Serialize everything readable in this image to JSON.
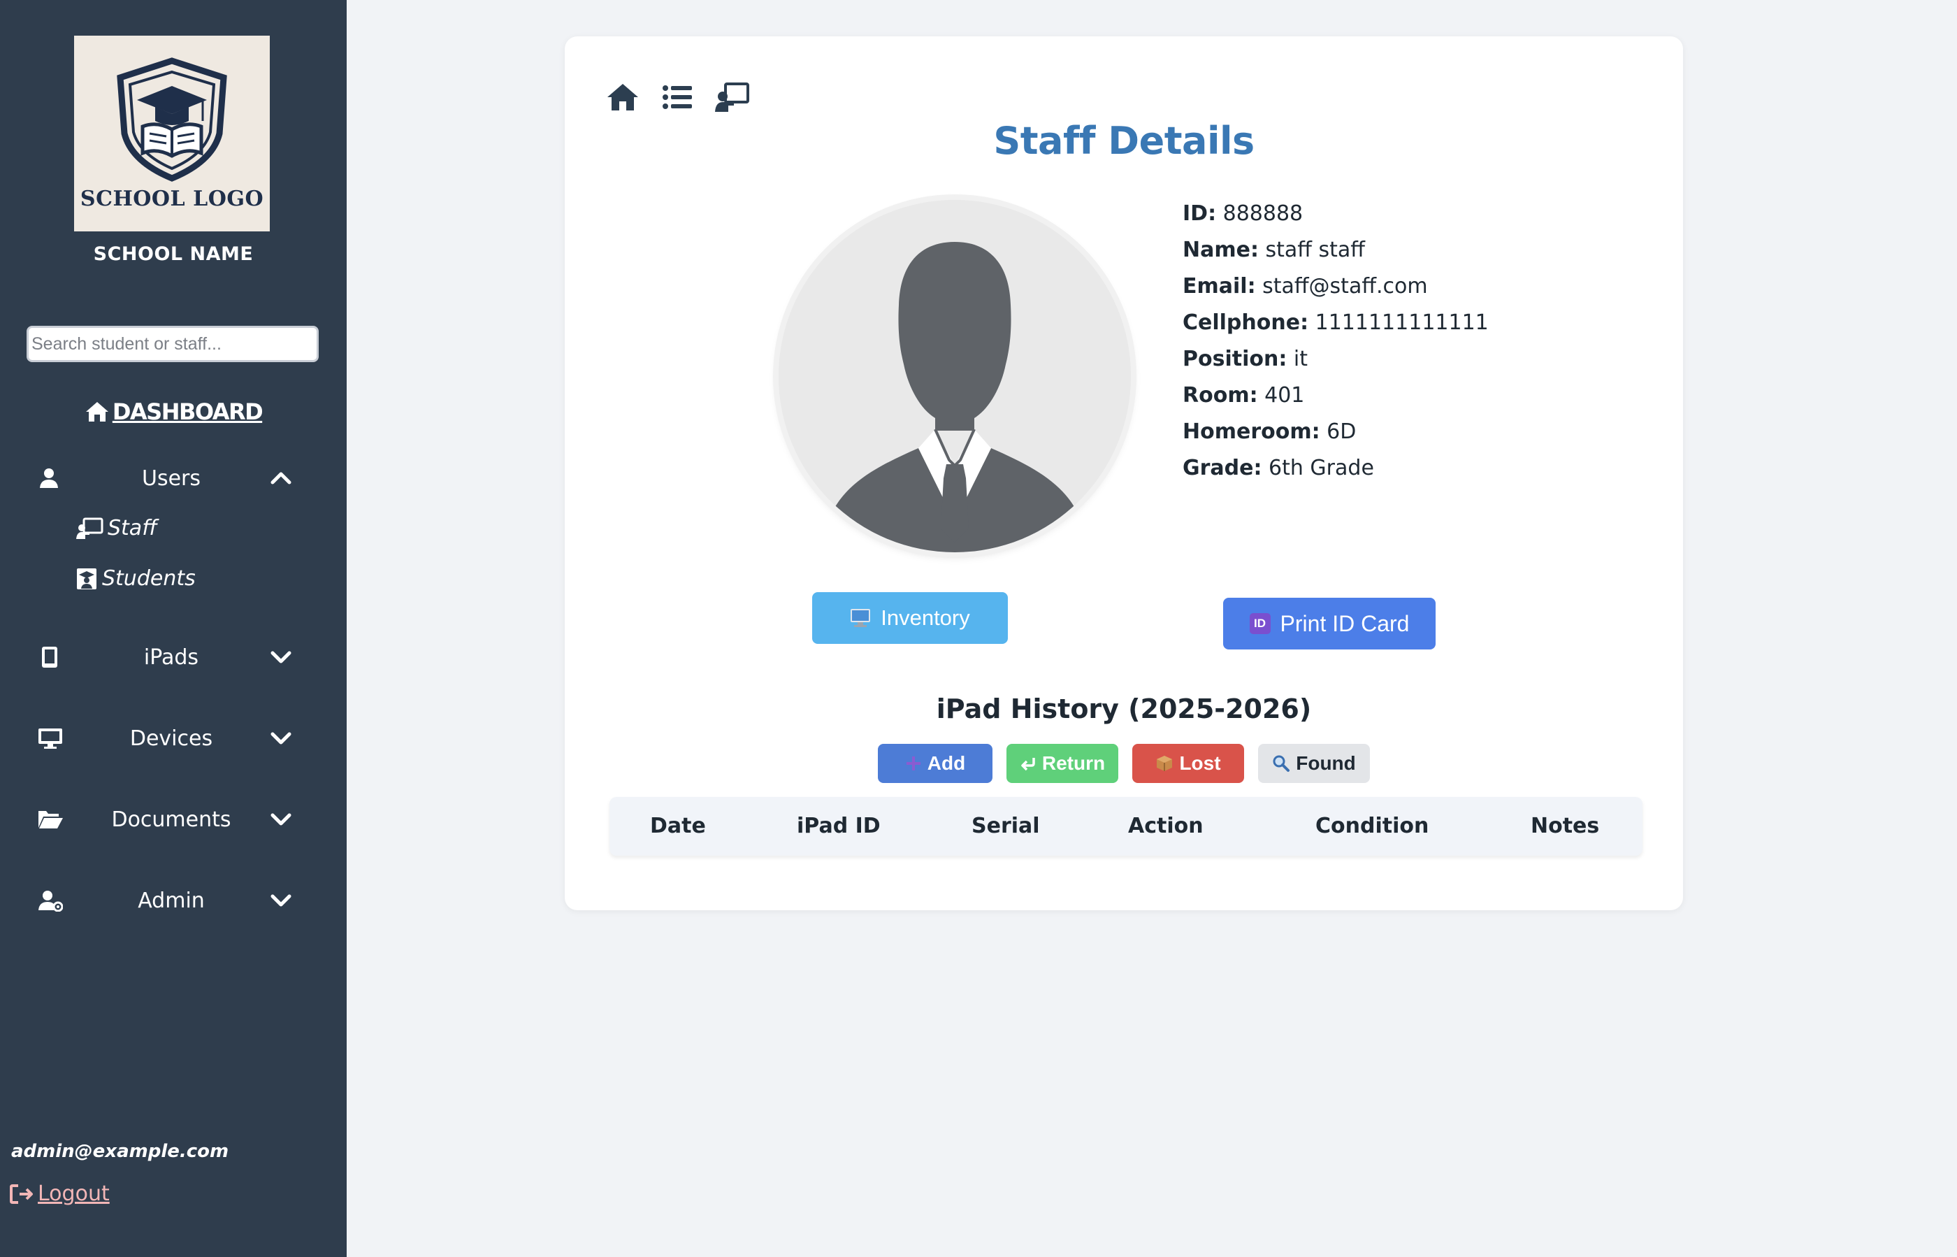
{
  "sidebar": {
    "logo_text": "SCHOOL LOGO",
    "school_name": "SCHOOL NAME",
    "search_placeholder": "Search student or staff...",
    "dashboard_label": "DASHBOARD",
    "nav": {
      "users": "Users",
      "staff": "Staff",
      "students": "Students",
      "ipads": "iPads",
      "devices": "Devices",
      "documents": "Documents",
      "admin": "Admin"
    },
    "user_email": "admin@example.com",
    "logout_label": "Logout"
  },
  "page": {
    "title": "Staff Details"
  },
  "staff": {
    "id_label": "ID:",
    "id": "888888",
    "name_label": "Name:",
    "name": "staff staff",
    "email_label": "Email:",
    "email": "staff@staff.com",
    "cell_label": "Cellphone:",
    "cell": "1111111111111",
    "position_label": "Position:",
    "position": "it",
    "room_label": "Room:",
    "room": "401",
    "homeroom_label": "Homeroom:",
    "homeroom": "6D",
    "grade_label": "Grade:",
    "grade": "6th Grade"
  },
  "actions": {
    "inventory": "Inventory",
    "print_id": "Print ID Card",
    "id_badge": "ID"
  },
  "history": {
    "title": "iPad History (2025-2026)",
    "add": "Add",
    "return": "Return",
    "lost": "Lost",
    "found": "Found",
    "columns": [
      "Date",
      "iPad ID",
      "Serial",
      "Action",
      "Condition",
      "Notes"
    ]
  },
  "colors": {
    "sidebar_bg": "#2f3d4d",
    "title_blue": "#3a78b4",
    "inventory_btn": "#56b4ee",
    "print_btn": "#4c7ee8",
    "add_btn": "#4d7cd6",
    "return_btn": "#5fd07a",
    "lost_btn": "#d9534a",
    "found_btn": "#e3e5e8"
  },
  "icons": [
    "graduation-cap-shield-icon",
    "home-icon",
    "list-icon",
    "chalkboard-teacher-icon",
    "user-icon",
    "chevron-up-icon",
    "chevron-down-icon",
    "tablet-icon",
    "monitor-icon",
    "folder-open-icon",
    "user-gear-icon",
    "sign-out-icon",
    "computer-icon",
    "plus-icon",
    "return-arrow-icon",
    "package-icon",
    "magnifier-icon"
  ]
}
